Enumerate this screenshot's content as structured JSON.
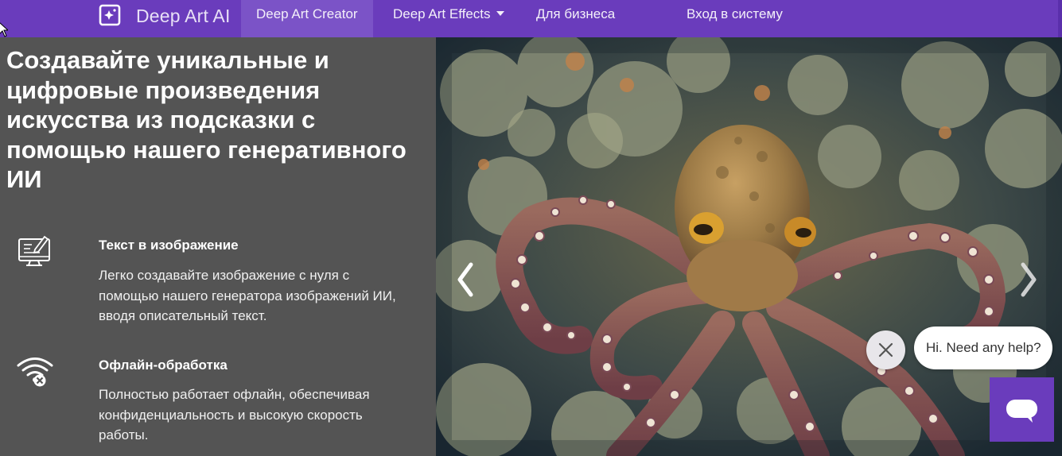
{
  "nav": {
    "brand": "Deep Art AI",
    "items": [
      {
        "label": "Deep Art Creator",
        "active": true
      },
      {
        "label": "Deep Art Effects",
        "has_dropdown": true
      },
      {
        "label": "Для бизнеса"
      },
      {
        "label": "Вход в систему"
      }
    ],
    "colors": {
      "bar": "#6a3cbc",
      "active": "#7d55c8"
    }
  },
  "hero": {
    "headline": "Создавайте уникальные и цифровые произведения искусства из подсказки с помощью нашего генеративного ИИ",
    "features": [
      {
        "icon": "monitor-pen-icon",
        "title": "Текст в изображение",
        "description": "Легко создавайте изображение с нуля с помощью нашего генератора изображений ИИ, вводя описательный текст."
      },
      {
        "icon": "wifi-off-icon",
        "title": "Офлайн-обработка",
        "description": "Полностью работает офлайн, обеспечивая конфиденциальность и высокую скорость работы."
      }
    ]
  },
  "carousel": {
    "prev_icon": "chevron-left-icon",
    "next_icon": "chevron-right-icon",
    "image_subject": "octopus-image"
  },
  "chat": {
    "greeting": "Hi. Need any help?",
    "close_icon": "close-icon",
    "launcher_icon": "chat-icon",
    "color": "#6a3cbc"
  }
}
